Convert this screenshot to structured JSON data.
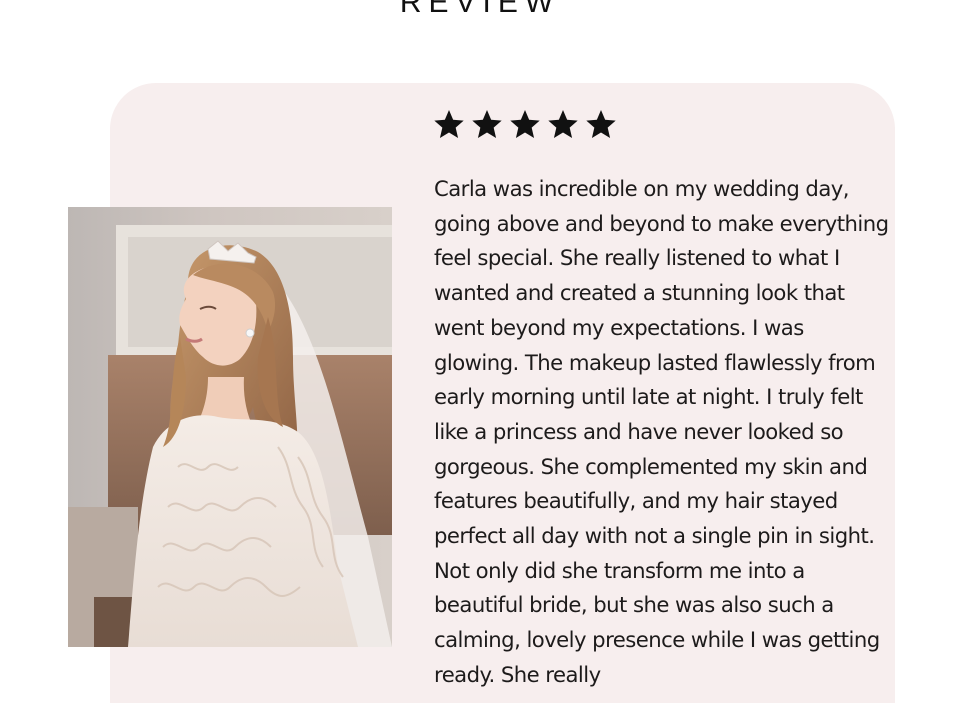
{
  "heading": "REVIEW",
  "rating": {
    "value": 5,
    "max": 5
  },
  "review": {
    "paragraphs": [
      "Carla was incredible on my wedding day, going above and beyond to make everything feel special. She really listened to what I wanted and created a stunning look that went beyond my expectations. I was glowing. The makeup lasted flawlessly from early morning until late at night. I truly felt like a princess and have never looked so gorgeous. She complemented my skin and features beautifully, and my hair stayed perfect all day with not a single pin in sight.",
      "Not only did she transform me into a beautiful bride, but she was also such a calming, lovely presence while I was getting ready. She really"
    ]
  },
  "photo": {
    "subject": "bride-photo"
  },
  "colors": {
    "card_background": "#f7eeee",
    "star": "#111111"
  }
}
